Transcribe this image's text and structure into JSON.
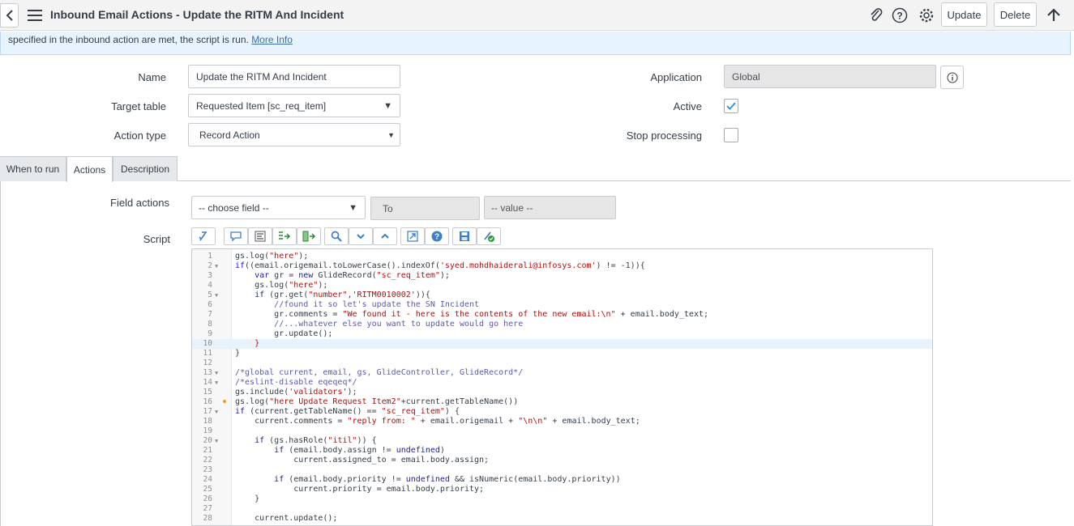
{
  "header": {
    "title": "Inbound Email Actions - Update the RITM And Incident",
    "update_label": "Update",
    "delete_label": "Delete"
  },
  "banner": {
    "text": "specified in the inbound action are met, the script is run.",
    "link": "More Info"
  },
  "form": {
    "name_label": "Name",
    "name_value": "Update the RITM And Incident",
    "target_table_label": "Target table",
    "target_table_value": "Requested Item [sc_req_item]",
    "action_type_label": "Action type",
    "action_type_value": "Record Action",
    "application_label": "Application",
    "application_value": "Global",
    "active_label": "Active",
    "active_checked": true,
    "stop_processing_label": "Stop processing",
    "stop_processing_checked": false
  },
  "tabs": [
    {
      "label": "When to run"
    },
    {
      "label": "Actions"
    },
    {
      "label": "Description"
    }
  ],
  "actions": {
    "field_actions_label": "Field actions",
    "choose_field": "-- choose field --",
    "to_label": "To",
    "value_placeholder": "-- value --",
    "script_label": "Script"
  },
  "toolbar_icons": [
    "format-icon",
    "comment-icon",
    "align-icon",
    "find-replace-icon",
    "replace-all-icon",
    "search-icon",
    "fold-down-icon",
    "fold-up-icon",
    "fullscreen-icon",
    "help-icon",
    "save-icon",
    "syntax-check-icon"
  ],
  "colors": {
    "accent": "#278efc",
    "banner_bg": "#e8f4fd",
    "header_bg": "#f3f3f3"
  }
}
